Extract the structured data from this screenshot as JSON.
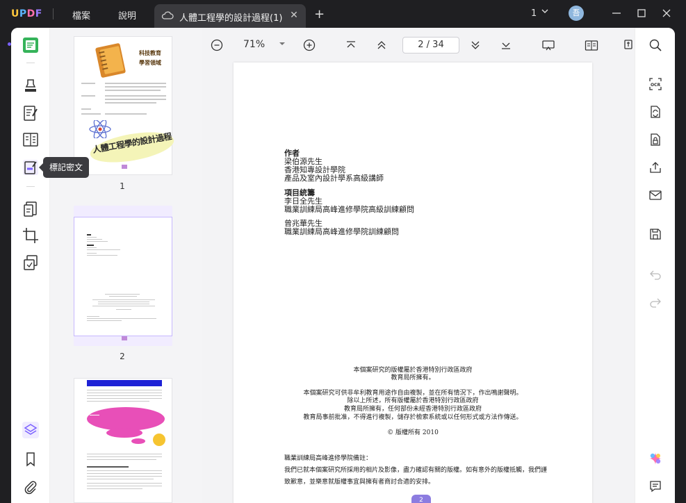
{
  "app": {
    "logo": "UPDF",
    "menu": [
      "檔案",
      "說明"
    ],
    "tab_title": "人體工程學的設計過程(1)",
    "tab_close": "✕",
    "new_tab": "+",
    "tab_count": "1",
    "avatar_initial": "吾"
  },
  "left_rail": {
    "tooltip": "標記密文"
  },
  "thumbnails": {
    "pages": [
      {
        "number": "1",
        "title_line1": "科技教育",
        "title_line2": "學習領域",
        "banner": "人體工程學的設計過程"
      },
      {
        "number": "2"
      },
      {
        "number": "3"
      }
    ]
  },
  "toolbar": {
    "zoom": "71%",
    "page_indicator": "2 / 34"
  },
  "document": {
    "author_heading": "作者",
    "author_lines": [
      "梁伯源先生",
      "香港知專設計學院",
      "產品及室內設計學系高級講師"
    ],
    "coord_heading": "項目統籌",
    "coord_lines": [
      "李日全先生",
      "職業訓練局高峰進修學院高級訓練顧問"
    ],
    "coord2_lines": [
      "曾兆華先生",
      "職業訓練局高峰進修學院訓練顧問"
    ],
    "copyright_lines": [
      "本個案研究的版權屬於香港特別行政區政府",
      "教育局所擁有。",
      "本個案研究可供非牟利教育用途作自由複製，並在所有情況下，作出鳴謝聲明。",
      "除以上所述，所有版權屬於香港特別行政區政府",
      "教育局所擁有，任何部份未經香港特別行政區政府",
      "教育局事前批准，不得進行複製，儲存於檢索系統或以任何形式或方法作傳送。",
      "© 版權所有 2010"
    ],
    "notes_heading": "職業訓練局高峰進修學院備註：",
    "notes_lines": [
      "我們已就本個案研究所採用的相片及影像，盡力確認有關的版權。如有意外的版權抵觸，我們謹",
      "致歉意，並樂意就版權事宜與擁有者商討合適的安排。"
    ],
    "page_mark": "2"
  },
  "colors": {
    "accent": "#7b61ff",
    "selected_thumb_border": "#c7b8ff",
    "selected_thumb_bg": "#f1ecff",
    "rail_active": "#35b35a"
  }
}
